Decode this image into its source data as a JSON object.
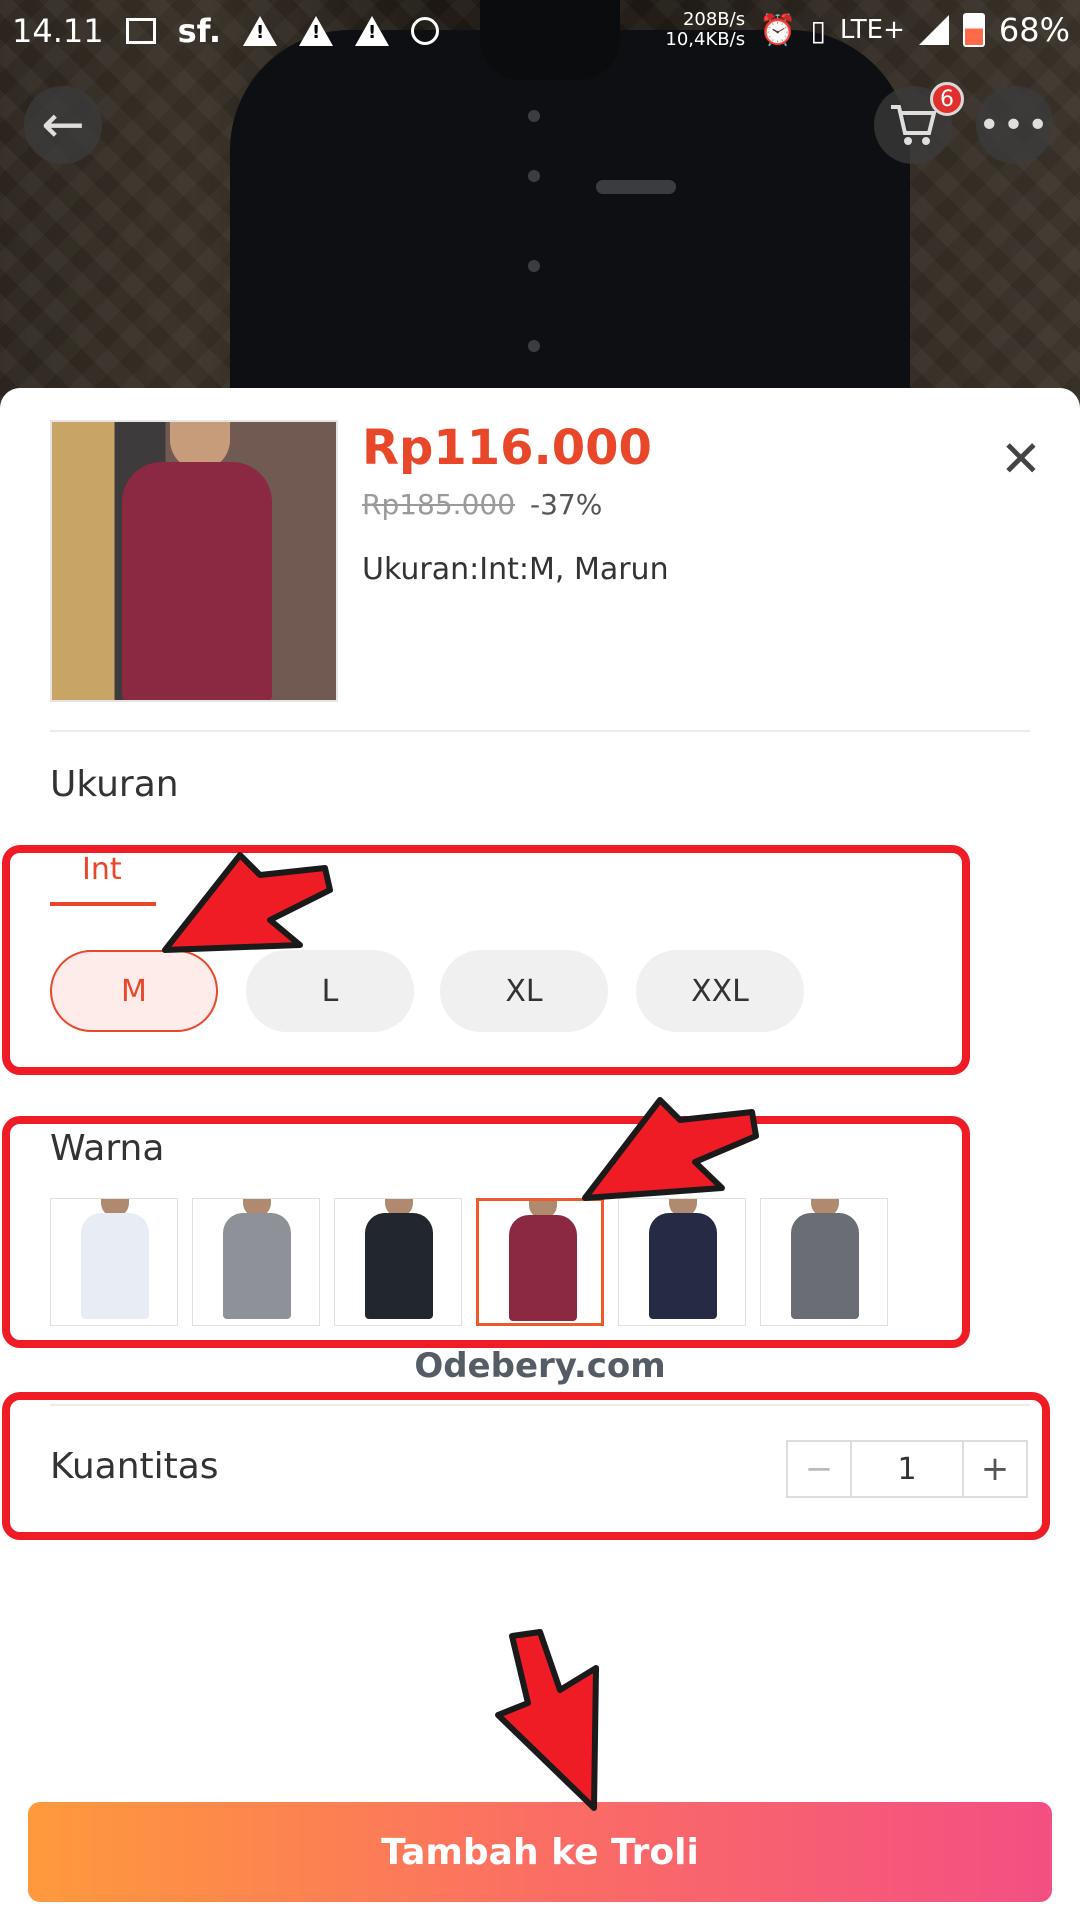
{
  "status_bar": {
    "time": "14.11",
    "carrier_icon": "sf.",
    "net_up": "208B/s",
    "net_down": "10,4KB/s",
    "network": "LTE+",
    "battery": "68%"
  },
  "header": {
    "cart_badge": "6"
  },
  "product": {
    "price": "Rp116.000",
    "original_price": "Rp185.000",
    "discount": "-37%",
    "selected_variant": "Ukuran:Int:M, Marun"
  },
  "size": {
    "label": "Ukuran",
    "tab": "Int",
    "options": [
      "M",
      "L",
      "XL",
      "XXL"
    ],
    "selected": "M"
  },
  "color": {
    "label": "Warna",
    "swatches": [
      {
        "name": "white",
        "color": "#e8ecf4"
      },
      {
        "name": "grey",
        "color": "#8e9197"
      },
      {
        "name": "black",
        "color": "#22262e"
      },
      {
        "name": "maroon",
        "color": "#8a2941"
      },
      {
        "name": "navy",
        "color": "#262a45"
      },
      {
        "name": "charcoal",
        "color": "#6b6d74"
      }
    ],
    "selected_index": 3
  },
  "watermark": "Odebery.com",
  "quantity": {
    "label": "Kuantitas",
    "value": "1",
    "minus": "−",
    "plus": "+"
  },
  "add_to_cart_label": "Tambah ke Troli",
  "colors": {
    "accent": "#e8472a",
    "annotation": "#ef1c25"
  }
}
